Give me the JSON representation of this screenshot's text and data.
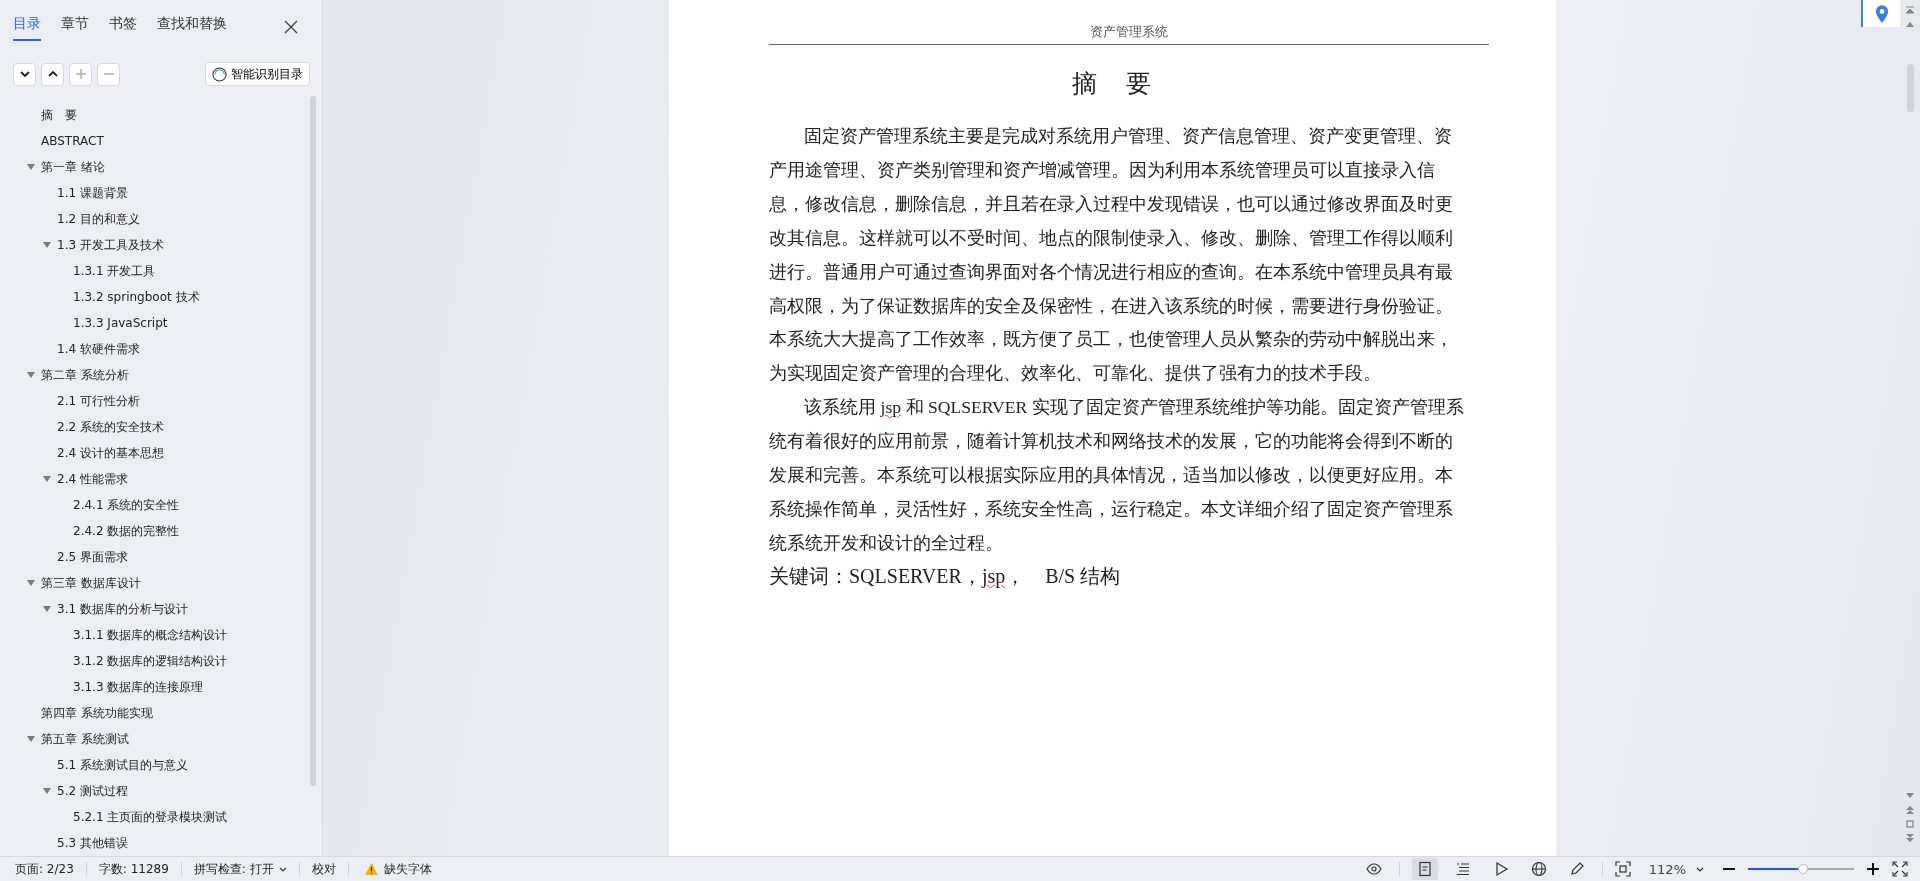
{
  "sidebar": {
    "tabs": [
      {
        "label": "目录",
        "selected": true
      },
      {
        "label": "章节",
        "selected": false
      },
      {
        "label": "书签",
        "selected": false
      },
      {
        "label": "查找和替换",
        "selected": false
      }
    ],
    "smart_button": "智能识别目录",
    "toc": [
      {
        "label": "摘　要"
      },
      {
        "label": "ABSTRACT"
      },
      {
        "label": "第一章  绪论",
        "expanded": true,
        "children": [
          {
            "label": "1.1 课题背景"
          },
          {
            "label": "1.2 目的和意义"
          },
          {
            "label": "1.3 开发工具及技术",
            "expanded": true,
            "children": [
              {
                "label": "1.3.1 开发工具"
              },
              {
                "label": "1.3.2 springboot 技术"
              },
              {
                "label": "1.3.3 JavaScript"
              }
            ]
          },
          {
            "label": "1.4 软硬件需求"
          }
        ]
      },
      {
        "label": "第二章  系统分析",
        "expanded": true,
        "children": [
          {
            "label": "2.1 可行性分析"
          },
          {
            "label": "2.2  系统的安全技术"
          },
          {
            "label": "2.4 设计的基本思想"
          },
          {
            "label": "2.4 性能需求",
            "expanded": true,
            "children": [
              {
                "label": "2.4.1 系统的安全性"
              },
              {
                "label": "2.4.2 数据的完整性"
              }
            ]
          },
          {
            "label": "2.5 界面需求"
          }
        ]
      },
      {
        "label": "第三章  数据库设计",
        "expanded": true,
        "children": [
          {
            "label": "3.1 数据库的分析与设计",
            "expanded": true,
            "children": [
              {
                "label": "3.1.1 数据库的概念结构设计"
              },
              {
                "label": "3.1.2 数据库的逻辑结构设计"
              },
              {
                "label": "3.1.3 数据库的连接原理"
              }
            ]
          }
        ]
      },
      {
        "label": "第四章  系统功能实现"
      },
      {
        "label": "第五章  系统测试",
        "expanded": true,
        "children": [
          {
            "label": "5.1 系统测试目的与意义"
          },
          {
            "label": "5.2 测试过程",
            "expanded": true,
            "children": [
              {
                "label": "5.2.1 主页面的登录模块测试"
              }
            ]
          },
          {
            "label": "5.3 其他错误"
          }
        ]
      }
    ]
  },
  "document": {
    "header": "资产管理系统",
    "title": "摘　要",
    "paragraphs": [
      [
        {
          "text": "固定资产管理系统主要是完成对系统用户管理、资产信息管理、资产变更管理、资产用途管理、资产类别管理和资产增减管理。因为利用本系统管理员可以直接录入信息，修改信息，删除信息，并且若在录入过程中发现错误，也可以通过修改界面及时更改其信息。这样就可以不受时间、地点的限制使录入、修改、删除、管理工作得以顺利进行。普通用户可通过查询界面对各个情况进行相应的查询。在本系统中管理员具有最高权限，为了保证数据库的安全及保密性，在进入该系统的时候，需要进行身份验证。本系统大大提高了工作效率，既方便了员工，也使管理人员从繁杂的劳动中解脱出来，为实现固定资产管理的合理化、效率化、可靠化、提供了强有力的技术手段。",
          "misspelled": false
        }
      ],
      [
        {
          "text": "该系统用 ",
          "misspelled": false
        },
        {
          "text": "jsp",
          "misspelled": true
        },
        {
          "text": " 和 SQLSERVER 实现了固定资产管理系统维护等功能。固定资产管理系统有着很好的应用前景，随着计算机技术和网络技术的发展，它的功能将会得到不断的发展和完善。本系统可以根据实际应用的具体情况，适当加以修改，以便更好应用。本系统操作简单，灵活性好，系统安全性高，运行稳定。本文详细介绍了固定资产管理系统系统开发和设计的全过程。",
          "misspelled": false
        }
      ]
    ],
    "keywords": [
      {
        "text": "关键词：SQLSERVER，",
        "misspelled": false
      },
      {
        "text": "jsp",
        "misspelled": true
      },
      {
        "text": "，　B/S 结构",
        "misspelled": false
      }
    ]
  },
  "status_bar": {
    "page": "页面: 2/23",
    "words": "字数: 11289",
    "spellcheck": "拼写检查: 打开",
    "proofread": "校对",
    "missing_fonts": "缺失字体",
    "zoom": "112%",
    "zoom_level": {
      "level": 0.52
    },
    "views": [
      {
        "kind": "eye",
        "selected": false
      },
      {
        "kind": "page",
        "selected": true
      },
      {
        "kind": "outline",
        "selected": false
      },
      {
        "kind": "play",
        "selected": false
      },
      {
        "kind": "web",
        "selected": false
      },
      {
        "kind": "pen",
        "selected": false
      }
    ]
  }
}
